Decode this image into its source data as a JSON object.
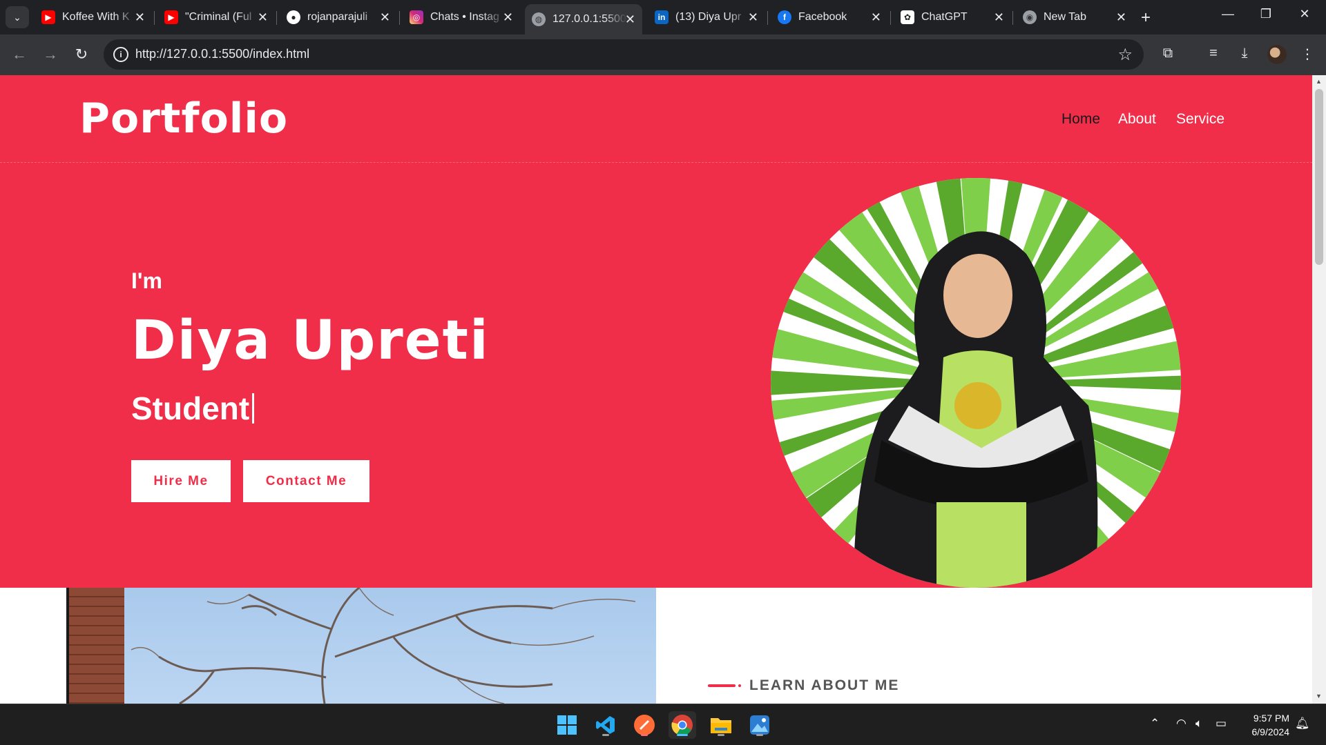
{
  "browser": {
    "tabs": [
      {
        "title": "Koffee With K",
        "favicon": "youtube-icon",
        "color": "#ff0000"
      },
      {
        "title": "\"Criminal (Ful",
        "favicon": "youtube-icon",
        "color": "#ff0000"
      },
      {
        "title": "rojanparajuli",
        "favicon": "github-icon",
        "color": "#ffffff"
      },
      {
        "title": "Chats • Instag",
        "favicon": "instagram-icon",
        "color": "#d6249f"
      },
      {
        "title": "127.0.0.1:5500",
        "favicon": "globe-icon",
        "color": "#9aa0a6",
        "active": true
      },
      {
        "title": "(13) Diya Upr",
        "favicon": "linkedin-icon",
        "color": "#0a66c2"
      },
      {
        "title": "Facebook",
        "favicon": "facebook-icon",
        "color": "#1877f2"
      },
      {
        "title": "ChatGPT",
        "favicon": "chatgpt-icon",
        "color": "#ffffff"
      },
      {
        "title": "New Tab",
        "favicon": "chrome-icon",
        "color": "#9aa0a6"
      }
    ],
    "url": "http://127.0.0.1:5500/index.html"
  },
  "page": {
    "logo": "Portfolio",
    "nav": [
      "Home",
      "About",
      "Service"
    ],
    "hero": {
      "intro": "I'm",
      "name": "Diya Upreti",
      "role": "Student",
      "buttons": [
        "Hire Me",
        "Contact Me"
      ]
    },
    "about": {
      "kicker": "LEARN ABOUT ME"
    }
  },
  "taskbar": {
    "time": "9:57 PM",
    "date": "6/9/2024",
    "apps": [
      "windows-start-icon",
      "vscode-icon",
      "postman-icon",
      "chrome-icon",
      "file-explorer-icon",
      "photos-icon"
    ]
  },
  "colors": {
    "accent": "#f02e4a",
    "chrome_dark": "#202124",
    "chrome_toolbar": "#35363a"
  }
}
